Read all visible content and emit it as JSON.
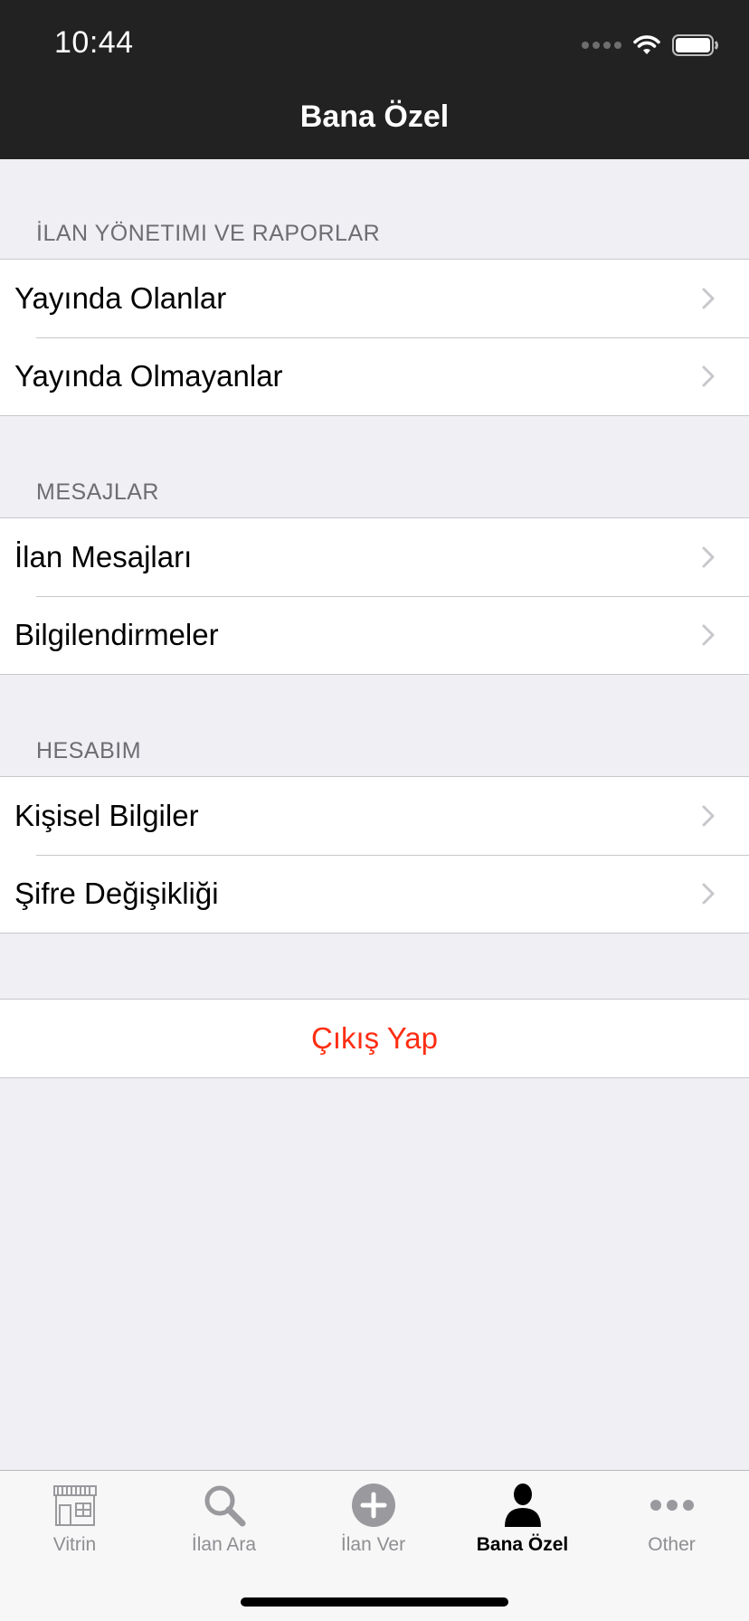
{
  "status_bar": {
    "time": "10:44"
  },
  "nav": {
    "title": "Bana Özel"
  },
  "sections": [
    {
      "header": "İLAN YÖNETIMI VE RAPORLAR",
      "items": [
        {
          "label": "Yayında Olanlar"
        },
        {
          "label": "Yayında Olmayanlar"
        }
      ]
    },
    {
      "header": "MESAJLAR",
      "items": [
        {
          "label": "İlan Mesajları"
        },
        {
          "label": "Bilgilendirmeler"
        }
      ]
    },
    {
      "header": "HESABIM",
      "items": [
        {
          "label": "Kişisel Bilgiler"
        },
        {
          "label": "Şifre Değişikliği"
        }
      ]
    }
  ],
  "logout": {
    "label": "Çıkış Yap",
    "color": "#ff2d12"
  },
  "tabbar": {
    "active": "Bana Özel",
    "tabs": [
      {
        "label": "Vitrin",
        "icon": "storefront-icon"
      },
      {
        "label": "İlan Ara",
        "icon": "magnifier-icon"
      },
      {
        "label": "İlan Ver",
        "icon": "plus-circle-icon"
      },
      {
        "label": "Bana Özel",
        "icon": "person-icon"
      },
      {
        "label": "Other",
        "icon": "more-dots-icon"
      }
    ]
  },
  "colors": {
    "header_bg": "#222222",
    "page_bg": "#efeff4",
    "tab_inactive": "#8e8e93"
  }
}
